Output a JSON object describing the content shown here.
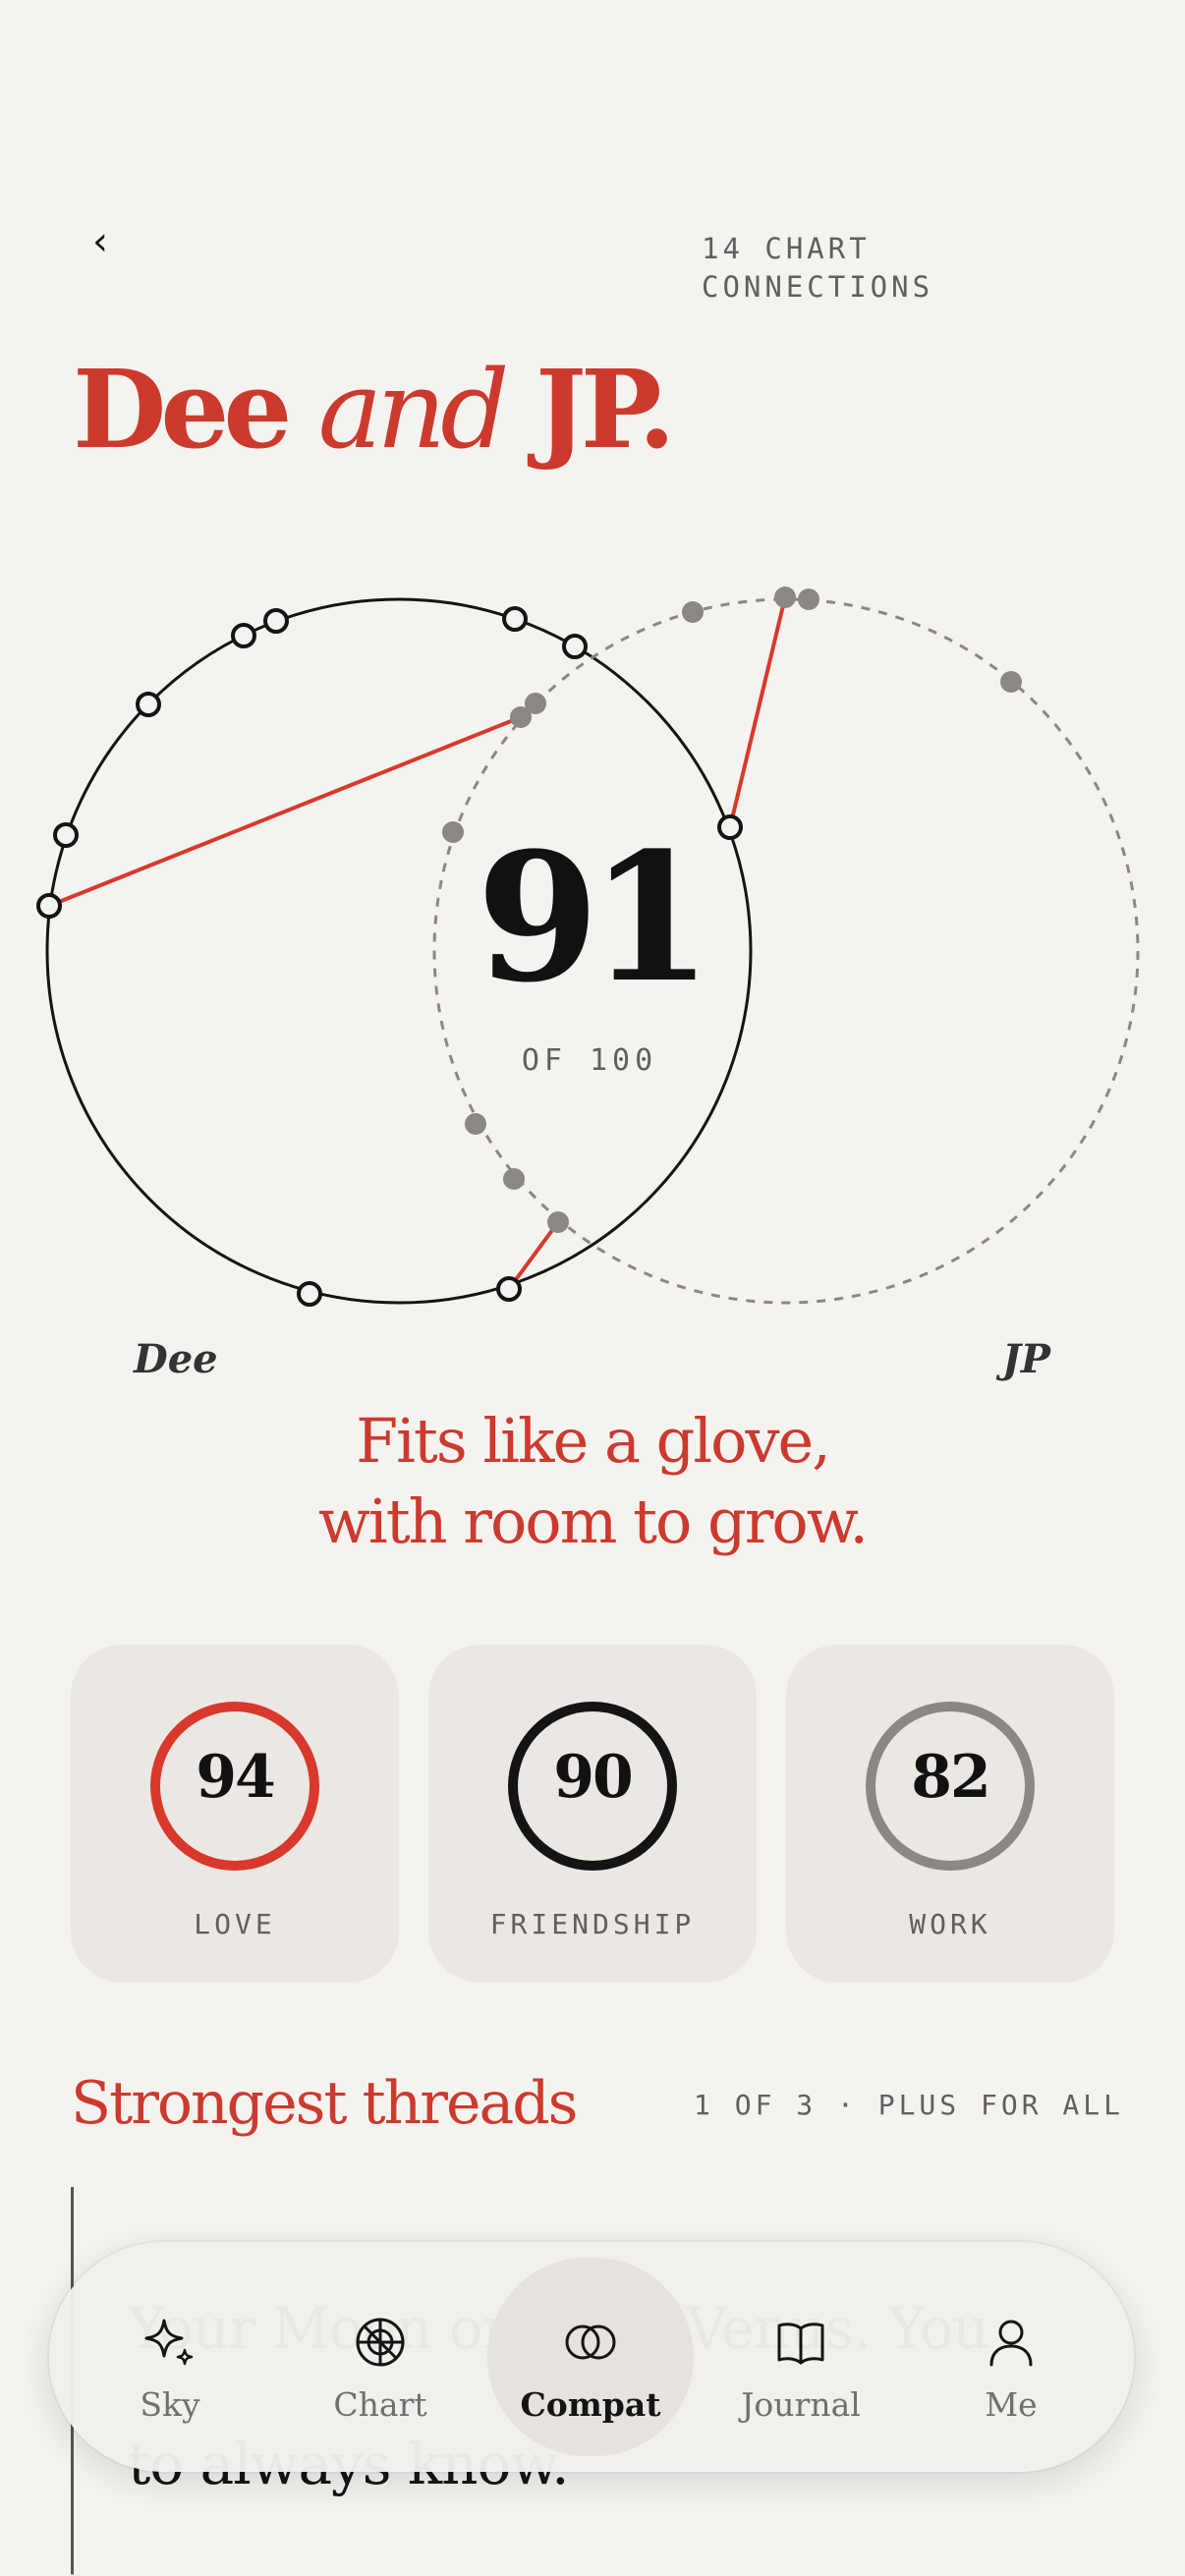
{
  "header": {
    "back_glyph": "‹",
    "connections_label": "14 CHART CONNECTIONS"
  },
  "title": {
    "name_a": "Dee",
    "conjunction": "and",
    "name_b": "JP."
  },
  "compatibility": {
    "score": "91",
    "score_of": "OF 100",
    "person_a": "Dee",
    "person_b": "JP",
    "tagline_line1": "Fits like a glove,",
    "tagline_line2": "with room to grow."
  },
  "categories": [
    {
      "label": "LOVE",
      "score": "94",
      "value": 94,
      "color": "#d8392c"
    },
    {
      "label": "FRIENDSHIP",
      "score": "90",
      "value": 90,
      "color": "#141414"
    },
    {
      "label": "WORK",
      "score": "82",
      "value": 82,
      "color": "#8a8784"
    }
  ],
  "threads": {
    "title": "Strongest threads",
    "meta": "1 OF 3 · PLUS FOR ALL",
    "text_visible_top": "Your Moon on their Venus. You",
    "text_visible_bottom": "to always know."
  },
  "nav": {
    "items": [
      {
        "label": "Sky",
        "icon": "sparkle-icon"
      },
      {
        "label": "Chart",
        "icon": "chart-wheel-icon"
      },
      {
        "label": "Compat",
        "icon": "overlapping-circles-icon",
        "active": true
      },
      {
        "label": "Journal",
        "icon": "open-book-icon"
      },
      {
        "label": "Me",
        "icon": "person-icon"
      }
    ]
  },
  "colors": {
    "accent": "#cc3a2e",
    "background": "#f5f3f0",
    "card": "#ebe8e4"
  }
}
